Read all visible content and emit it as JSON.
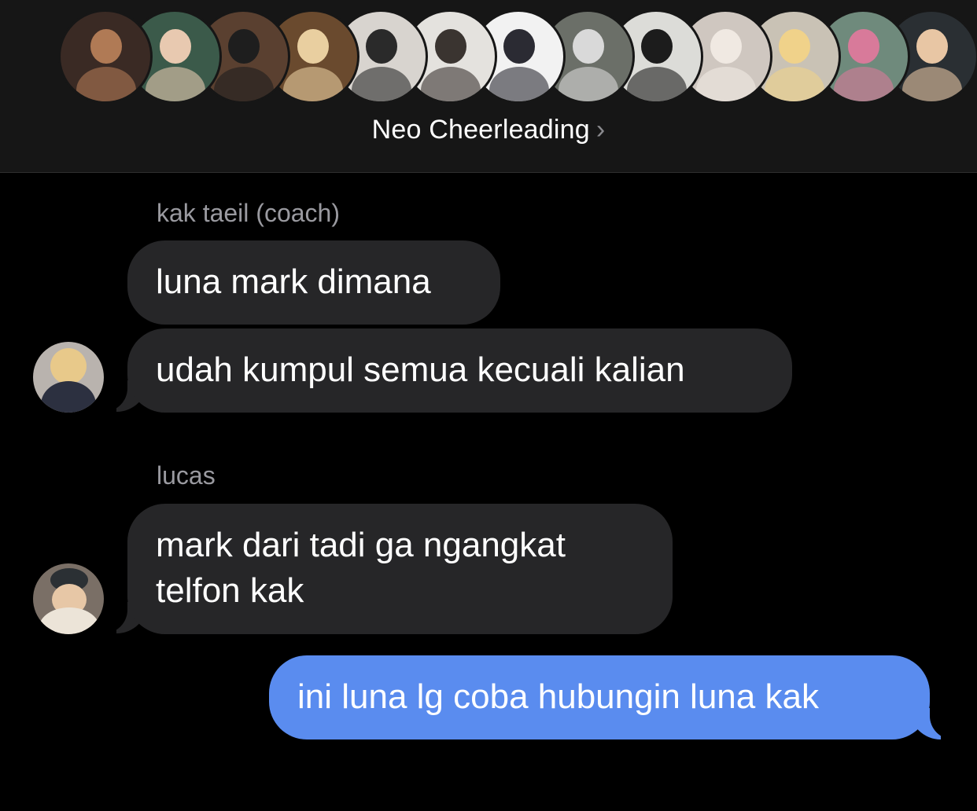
{
  "header": {
    "group_name": "Neo Cheerleading",
    "chevron": "›",
    "member_avatars": [
      {
        "name": "member-1",
        "bg": "#3a2a24",
        "fg": "#b07a55"
      },
      {
        "name": "member-2",
        "bg": "#3b5a4a",
        "fg": "#e8c9b0"
      },
      {
        "name": "member-3",
        "bg": "#5a4030",
        "fg": "#1e1e1e"
      },
      {
        "name": "member-4",
        "bg": "#6a4a2e",
        "fg": "#e9cfa0"
      },
      {
        "name": "member-5",
        "bg": "#d8d4cf",
        "fg": "#2a2a2a"
      },
      {
        "name": "member-6",
        "bg": "#e4e2de",
        "fg": "#3a3430"
      },
      {
        "name": "member-7",
        "bg": "#f2f2f2",
        "fg": "#2b2b33"
      },
      {
        "name": "member-8",
        "bg": "#6b6f68",
        "fg": "#d9d9d9"
      },
      {
        "name": "member-9",
        "bg": "#dcdcd8",
        "fg": "#1c1c1c"
      },
      {
        "name": "member-10",
        "bg": "#cfc7c0",
        "fg": "#f0e9e2"
      },
      {
        "name": "member-11",
        "bg": "#c9c2b5",
        "fg": "#f0d28a"
      },
      {
        "name": "member-12",
        "bg": "#6f8a7c",
        "fg": "#d87a9a"
      },
      {
        "name": "member-13",
        "bg": "#2a2f33",
        "fg": "#e8c6a4"
      }
    ]
  },
  "messages": [
    {
      "sender": "kak taeil (coach)",
      "text": "luna mark dimana",
      "direction": "incoming"
    },
    {
      "text": "udah kumpul semua kecuali kalian",
      "direction": "incoming"
    },
    {
      "sender": "lucas",
      "text_line1": "mark dari tadi ga ngangkat",
      "text_line2": "telfon kak",
      "direction": "incoming"
    },
    {
      "text": "ini luna lg coba hubungin luna kak",
      "direction": "outgoing"
    }
  ],
  "colors": {
    "incoming": "#262628",
    "outgoing": "#5a8cef",
    "background": "#000000",
    "header": "#161616"
  }
}
